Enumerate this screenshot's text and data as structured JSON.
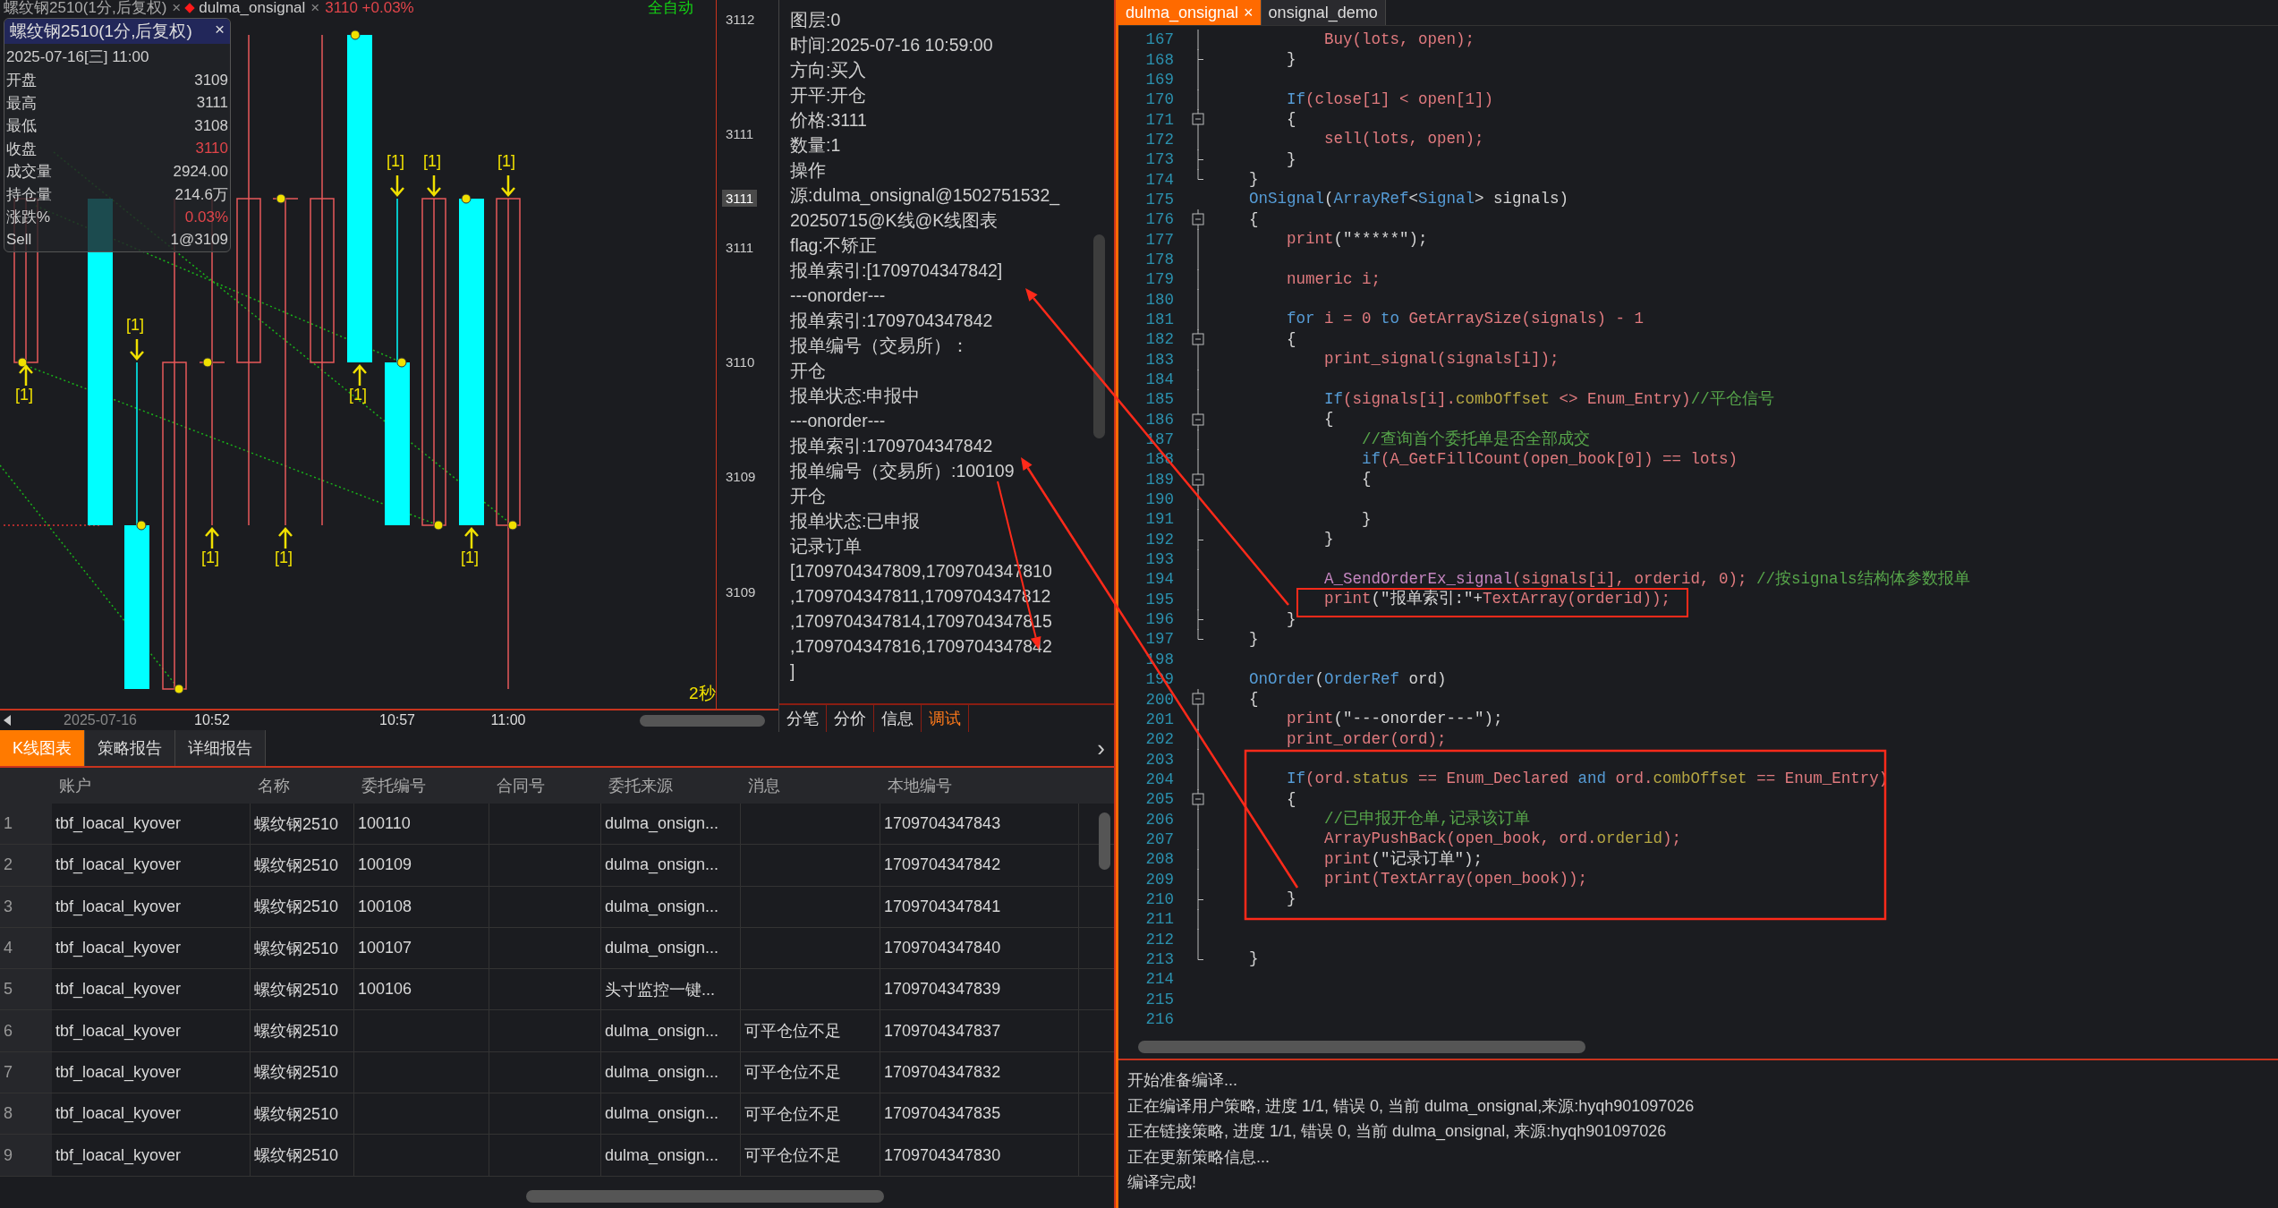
{
  "chart": {
    "header": {
      "symbol": "螺纹钢2510(1分,后复权)",
      "symbol_close": "×",
      "strategy": "dulma_onsignal",
      "strategy_close": "×",
      "quote": "3110 +0.03%",
      "mode": "全自动"
    },
    "tooltip": {
      "title": "螺纹钢2510(1分,后复权)",
      "close": "×",
      "datetime": "2025-07-16[三] 11:00",
      "rows": [
        {
          "label": "开盘",
          "value": "3109",
          "up": false
        },
        {
          "label": "最高",
          "value": "3111",
          "up": false
        },
        {
          "label": "最低",
          "value": "3108",
          "up": false
        },
        {
          "label": "收盘",
          "value": "3110",
          "up": true
        },
        {
          "label": "成交量",
          "value": "2924.00",
          "up": false
        },
        {
          "label": "持仓量",
          "value": "214.6万",
          "up": false
        },
        {
          "label": "涨跌%",
          "value": "0.03%",
          "up": true
        },
        {
          "label": "Sell",
          "value": "1@3109",
          "up": false
        }
      ]
    },
    "signals": [
      {
        "kind": "buy",
        "label": "[1]"
      },
      {
        "kind": "sell",
        "label": "[1]"
      },
      {
        "kind": "buy",
        "label": "[1]"
      },
      {
        "kind": "buy",
        "label": "[1]"
      },
      {
        "kind": "buy",
        "label": "[1]"
      },
      {
        "kind": "sell",
        "label": "[1]"
      },
      {
        "kind": "sell",
        "label": "[1]"
      },
      {
        "kind": "buy",
        "label": "[1]"
      },
      {
        "kind": "sell",
        "label": "[1]"
      }
    ],
    "price_axis": [
      {
        "label": "3112",
        "current": false
      },
      {
        "label": "3111",
        "current": false
      },
      {
        "label": "3111",
        "current": true
      },
      {
        "label": "3111",
        "current": false
      },
      {
        "label": "3110",
        "current": false
      },
      {
        "label": "3109",
        "current": false
      },
      {
        "label": "3109",
        "current": false
      }
    ],
    "time_axis": [
      {
        "label": "2025-07-16",
        "kind": "date"
      },
      {
        "label": "10:52",
        "kind": "time"
      },
      {
        "label": "10:57",
        "kind": "time"
      },
      {
        "label": "11:00",
        "kind": "time"
      }
    ],
    "interval": "2秒"
  },
  "log": {
    "lines": [
      "图层:0",
      "时间:2025-07-16 10:59:00",
      "方向:买入",
      "开平:开仓",
      "价格:3111",
      "数量:1",
      "操作",
      "源:dulma_onsignal@1502751532_",
      "20250715@K线@K线图表",
      "flag:不矫正",
      "报单索引:[1709704347842]",
      "---onorder---",
      "报单索引:1709704347842",
      "报单编号（交易所）：",
      "开仓",
      "报单状态:申报中",
      "---onorder---",
      "报单索引:1709704347842",
      "报单编号（交易所）:100109",
      "开仓",
      "报单状态:已申报",
      "记录订单",
      "[1709704347809,1709704347810",
      ",1709704347811,1709704347812",
      ",1709704347814,1709704347815",
      ",1709704347816,1709704347842",
      "]"
    ],
    "tabs": [
      {
        "label": "分笔",
        "selected": false
      },
      {
        "label": "分价",
        "selected": false
      },
      {
        "label": "信息",
        "selected": false
      },
      {
        "label": "调试",
        "selected": true
      }
    ]
  },
  "bottom_tabs": [
    {
      "label": "K线图表",
      "selected": true
    },
    {
      "label": "策略报告",
      "selected": false
    },
    {
      "label": "详细报告",
      "selected": false
    }
  ],
  "bottom_tabs_more": "›",
  "table": {
    "columns": [
      "账户",
      "名称",
      "委托编号",
      "合同号",
      "委托来源",
      "消息",
      "本地编号"
    ],
    "rows": [
      {
        "index": "1",
        "account": "tbf_loacal_kyover",
        "name": "螺纹钢2510",
        "order_no": "100110",
        "source": "dulma_onsign...",
        "local_no": "1709704347843"
      },
      {
        "index": "2",
        "account": "tbf_loacal_kyover",
        "name": "螺纹钢2510",
        "order_no": "100109",
        "source": "dulma_onsign...",
        "local_no": "1709704347842"
      },
      {
        "index": "3",
        "account": "tbf_loacal_kyover",
        "name": "螺纹钢2510",
        "order_no": "100108",
        "source": "dulma_onsign...",
        "local_no": "1709704347841"
      },
      {
        "index": "4",
        "account": "tbf_loacal_kyover",
        "name": "螺纹钢2510",
        "order_no": "100107",
        "source": "dulma_onsign...",
        "local_no": "1709704347840"
      },
      {
        "index": "5",
        "account": "tbf_loacal_kyover",
        "name": "螺纹钢2510",
        "order_no": "100106",
        "source": "头寸监控一键...",
        "local_no": "1709704347839"
      },
      {
        "index": "6",
        "account": "tbf_loacal_kyover",
        "name": "螺纹钢2510",
        "source": "dulma_onsign...",
        "message": "可平仓位不足",
        "local_no": "1709704347837"
      },
      {
        "index": "7",
        "account": "tbf_loacal_kyover",
        "name": "螺纹钢2510",
        "source": "dulma_onsign...",
        "message": "可平仓位不足",
        "local_no": "1709704347832"
      },
      {
        "index": "8",
        "account": "tbf_loacal_kyover",
        "name": "螺纹钢2510",
        "source": "dulma_onsign...",
        "message": "可平仓位不足",
        "local_no": "1709704347835"
      },
      {
        "index": "9",
        "account": "tbf_loacal_kyover",
        "name": "螺纹钢2510",
        "source": "dulma_onsign...",
        "message": "可平仓位不足",
        "local_no": "1709704347830"
      }
    ]
  },
  "editor": {
    "tabs": [
      {
        "label": "dulma_onsignal",
        "close": "×",
        "selected": true
      },
      {
        "label": "onsignal_demo",
        "selected": false
      }
    ],
    "lines": [
      {
        "number": "167",
        "kind": "guide",
        "tokens": [
          {
            "kind": "name",
            "text": "Buy(lots, open);"
          }
        ]
      },
      {
        "number": "168",
        "kind": "tick",
        "tokens": [
          {
            "kind": "plain",
            "text": "}"
          }
        ]
      },
      {
        "number": "169",
        "kind": "guide"
      },
      {
        "number": "170",
        "kind": "guide",
        "tokens": [
          {
            "kind": "keyword",
            "text": "If"
          },
          {
            "kind": "name",
            "text": "(close[1] < open[1])"
          }
        ]
      },
      {
        "number": "171",
        "kind": "box",
        "tokens": [
          {
            "kind": "plain",
            "text": "{"
          }
        ]
      },
      {
        "number": "172",
        "kind": "guide",
        "tokens": [
          {
            "kind": "name",
            "text": "sell(lots, open);"
          }
        ]
      },
      {
        "number": "173",
        "kind": "tick",
        "tokens": [
          {
            "kind": "plain",
            "text": "}"
          }
        ]
      },
      {
        "number": "174",
        "kind": "end",
        "tokens": [
          {
            "kind": "plain",
            "text": "}"
          }
        ]
      },
      {
        "number": "175",
        "kind": "plain",
        "tokens": [
          {
            "kind": "keyword",
            "text": "OnSignal"
          },
          {
            "kind": "plain",
            "text": "("
          },
          {
            "kind": "keyword",
            "text": "ArrayRef"
          },
          {
            "kind": "plain",
            "text": "<"
          },
          {
            "kind": "keyword",
            "text": "Signal"
          },
          {
            "kind": "plain",
            "text": "> signals)"
          }
        ]
      },
      {
        "number": "176",
        "kind": "box",
        "tokens": [
          {
            "kind": "plain",
            "text": "{"
          }
        ]
      },
      {
        "number": "177",
        "kind": "guide",
        "tokens": [
          {
            "kind": "name",
            "text": "print"
          },
          {
            "kind": "plain",
            "text": "(\"*****\");"
          }
        ]
      },
      {
        "number": "178",
        "kind": "guide"
      },
      {
        "number": "179",
        "kind": "guide",
        "tokens": [
          {
            "kind": "name",
            "text": "numeric i;"
          }
        ]
      },
      {
        "number": "180",
        "kind": "guide"
      },
      {
        "number": "181",
        "kind": "guide",
        "tokens": [
          {
            "kind": "keyword",
            "text": "for"
          },
          {
            "kind": "name",
            "text": " i = 0 "
          },
          {
            "kind": "keyword",
            "text": "to"
          },
          {
            "kind": "name",
            "text": " GetArraySize(signals) - 1"
          }
        ]
      },
      {
        "number": "182",
        "kind": "box",
        "tokens": [
          {
            "kind": "plain",
            "text": "{"
          }
        ]
      },
      {
        "number": "183",
        "kind": "guide",
        "tokens": [
          {
            "kind": "name",
            "text": "print_signal(signals[i]);"
          }
        ]
      },
      {
        "number": "184",
        "kind": "guide"
      },
      {
        "number": "185",
        "kind": "guide",
        "tokens": [
          {
            "kind": "keyword",
            "text": "If"
          },
          {
            "kind": "name",
            "text": "(signals[i]."
          },
          {
            "kind": "field",
            "text": "combOffset"
          },
          {
            "kind": "name",
            "text": " <> Enum_Entry)"
          },
          {
            "kind": "comment",
            "text": "//平仓信号"
          }
        ]
      },
      {
        "number": "186",
        "kind": "box",
        "tokens": [
          {
            "kind": "plain",
            "text": "{"
          }
        ]
      },
      {
        "number": "187",
        "kind": "guide",
        "tokens": [
          {
            "kind": "comment",
            "text": "//查询首个委托单是否全部成交"
          }
        ]
      },
      {
        "number": "188",
        "kind": "guide",
        "tokens": [
          {
            "kind": "keyword",
            "text": "if"
          },
          {
            "kind": "name",
            "text": "(A_GetFillCount(open_book[0]) == lots)"
          }
        ]
      },
      {
        "number": "189",
        "kind": "box",
        "tokens": [
          {
            "kind": "plain",
            "text": "{"
          }
        ]
      },
      {
        "number": "190",
        "kind": "guide"
      },
      {
        "number": "191",
        "kind": "guide",
        "tokens": [
          {
            "kind": "plain",
            "text": "}"
          }
        ]
      },
      {
        "number": "192",
        "kind": "tick",
        "tokens": [
          {
            "kind": "plain",
            "text": "}"
          }
        ]
      },
      {
        "number": "193",
        "kind": "guide"
      },
      {
        "number": "194",
        "kind": "guide",
        "tokens": [
          {
            "kind": "special",
            "text": "A_SendOrderEx_signal"
          },
          {
            "kind": "name",
            "text": "(signals[i], orderid, 0); "
          },
          {
            "kind": "comment",
            "text": "//按signals结构体参数报单"
          }
        ]
      },
      {
        "number": "195",
        "kind": "guide",
        "tokens": [
          {
            "kind": "name",
            "text": "print"
          },
          {
            "kind": "plain",
            "text": "(\"报单索引:\"+"
          },
          {
            "kind": "name",
            "text": "TextArray(orderid));"
          }
        ]
      },
      {
        "number": "196",
        "kind": "tick",
        "tokens": [
          {
            "kind": "plain",
            "text": "}"
          }
        ]
      },
      {
        "number": "197",
        "kind": "end",
        "tokens": [
          {
            "kind": "plain",
            "text": "}"
          }
        ]
      },
      {
        "number": "198",
        "kind": "plain"
      },
      {
        "number": "199",
        "kind": "plain",
        "tokens": [
          {
            "kind": "keyword",
            "text": "OnOrder"
          },
          {
            "kind": "plain",
            "text": "("
          },
          {
            "kind": "keyword",
            "text": "OrderRef"
          },
          {
            "kind": "plain",
            "text": " ord)"
          }
        ]
      },
      {
        "number": "200",
        "kind": "box",
        "tokens": [
          {
            "kind": "plain",
            "text": "{"
          }
        ]
      },
      {
        "number": "201",
        "kind": "guide",
        "tokens": [
          {
            "kind": "name",
            "text": "print"
          },
          {
            "kind": "plain",
            "text": "(\"---onorder---\");"
          }
        ]
      },
      {
        "number": "202",
        "kind": "guide",
        "tokens": [
          {
            "kind": "name",
            "text": "print_order(ord);"
          }
        ]
      },
      {
        "number": "203",
        "kind": "guide"
      },
      {
        "number": "204",
        "kind": "guide",
        "tokens": [
          {
            "kind": "keyword",
            "text": "If"
          },
          {
            "kind": "name",
            "text": "(ord."
          },
          {
            "kind": "field",
            "text": "status"
          },
          {
            "kind": "name",
            "text": " == Enum_Declared "
          },
          {
            "kind": "keyword",
            "text": "and"
          },
          {
            "kind": "name",
            "text": " ord."
          },
          {
            "kind": "field",
            "text": "combOffset"
          },
          {
            "kind": "name",
            "text": " == Enum_Entry)"
          }
        ]
      },
      {
        "number": "205",
        "kind": "box",
        "tokens": [
          {
            "kind": "plain",
            "text": "{"
          }
        ]
      },
      {
        "number": "206",
        "kind": "guide",
        "tokens": [
          {
            "kind": "comment",
            "text": "//已申报开仓单,记录该订单"
          }
        ]
      },
      {
        "number": "207",
        "kind": "guide",
        "tokens": [
          {
            "kind": "name",
            "text": "ArrayPushBack(open_book, ord."
          },
          {
            "kind": "field",
            "text": "orderid"
          },
          {
            "kind": "name",
            "text": ");"
          }
        ]
      },
      {
        "number": "208",
        "kind": "guide",
        "tokens": [
          {
            "kind": "name",
            "text": "print"
          },
          {
            "kind": "plain",
            "text": "(\"记录订单\");"
          }
        ]
      },
      {
        "number": "209",
        "kind": "guide",
        "tokens": [
          {
            "kind": "name",
            "text": "print(TextArray(open_book));"
          }
        ]
      },
      {
        "number": "210",
        "kind": "tick",
        "tokens": [
          {
            "kind": "plain",
            "text": "}"
          }
        ]
      },
      {
        "number": "211",
        "kind": "guide"
      },
      {
        "number": "212",
        "kind": "guide"
      },
      {
        "number": "213",
        "kind": "end",
        "tokens": [
          {
            "kind": "plain",
            "text": "}"
          }
        ]
      },
      {
        "number": "214",
        "kind": "plain"
      },
      {
        "number": "215",
        "kind": "plain"
      },
      {
        "number": "216",
        "kind": "plain"
      }
    ]
  },
  "output": [
    "开始准备编译...",
    "正在编译用户策略, 进度 1/1, 错误 0, 当前 dulma_onsignal,来源:hyqh901097026",
    "正在链接策略, 进度 1/1, 错误 0, 当前 dulma_onsignal, 来源:hyqh901097026",
    "正在更新策略信息...",
    "编译完成!"
  ]
}
